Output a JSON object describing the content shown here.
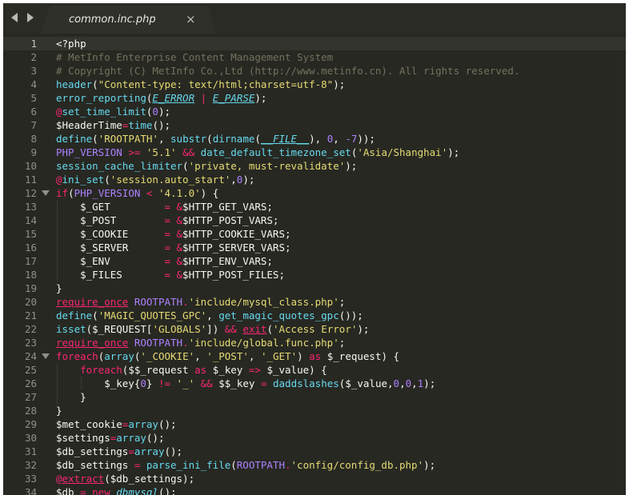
{
  "tabbar": {
    "back_icon": "chevron-left-icon",
    "forward_icon": "chevron-right-icon",
    "tab_title": "common.inc.php",
    "close_glyph": "×"
  },
  "editor": {
    "current_line": 1,
    "fold_lines": [
      12,
      24
    ],
    "lines": [
      {
        "n": "1",
        "tokens": [
          {
            "t": "<?php",
            "c": "d"
          }
        ]
      },
      {
        "n": "2",
        "tokens": [
          {
            "t": "# MetInfo Enterprise Content Management System",
            "c": "c"
          }
        ]
      },
      {
        "n": "3",
        "tokens": [
          {
            "t": "# Copyright (C) MetInfo Co.,Ltd (http://www.metinfo.cn). All rights reserved.",
            "c": "c"
          }
        ]
      },
      {
        "n": "4",
        "tokens": [
          {
            "t": "header",
            "c": "f"
          },
          {
            "t": "(",
            "c": "p"
          },
          {
            "t": "\"Content-type: text/html;charset=utf-8\"",
            "c": "s"
          },
          {
            "t": ");",
            "c": "p"
          }
        ]
      },
      {
        "n": "5",
        "tokens": [
          {
            "t": "error_reporting",
            "c": "f"
          },
          {
            "t": "(",
            "c": "p"
          },
          {
            "t": "E_ERROR",
            "c": "u"
          },
          {
            "t": " | ",
            "c": "k"
          },
          {
            "t": "E_PARSE",
            "c": "u"
          },
          {
            "t": ");",
            "c": "p"
          }
        ]
      },
      {
        "n": "6",
        "tokens": [
          {
            "t": "@",
            "c": "k"
          },
          {
            "t": "set_time_limit",
            "c": "f"
          },
          {
            "t": "(",
            "c": "p"
          },
          {
            "t": "0",
            "c": "n"
          },
          {
            "t": ");",
            "c": "p"
          }
        ]
      },
      {
        "n": "7",
        "tokens": [
          {
            "t": "$HeaderTime",
            "c": "v"
          },
          {
            "t": "=",
            "c": "k"
          },
          {
            "t": "time",
            "c": "f"
          },
          {
            "t": "();",
            "c": "p"
          }
        ]
      },
      {
        "n": "8",
        "tokens": [
          {
            "t": "define",
            "c": "f"
          },
          {
            "t": "(",
            "c": "p"
          },
          {
            "t": "'ROOTPATH'",
            "c": "s"
          },
          {
            "t": ", ",
            "c": "p"
          },
          {
            "t": "substr",
            "c": "f"
          },
          {
            "t": "(",
            "c": "p"
          },
          {
            "t": "dirname",
            "c": "f"
          },
          {
            "t": "(",
            "c": "p"
          },
          {
            "t": "__FILE__",
            "c": "u"
          },
          {
            "t": "), ",
            "c": "p"
          },
          {
            "t": "0",
            "c": "n"
          },
          {
            "t": ", ",
            "c": "p"
          },
          {
            "t": "-7",
            "c": "n"
          },
          {
            "t": "));",
            "c": "p"
          }
        ]
      },
      {
        "n": "9",
        "tokens": [
          {
            "t": "PHP_VERSION",
            "c": "cst"
          },
          {
            "t": " >= ",
            "c": "k"
          },
          {
            "t": "'5.1'",
            "c": "s"
          },
          {
            "t": " && ",
            "c": "k"
          },
          {
            "t": "date_default_timezone_set",
            "c": "f"
          },
          {
            "t": "(",
            "c": "p"
          },
          {
            "t": "'Asia/Shanghai'",
            "c": "s"
          },
          {
            "t": ");",
            "c": "p"
          }
        ]
      },
      {
        "n": "10",
        "tokens": [
          {
            "t": "session_cache_limiter",
            "c": "f"
          },
          {
            "t": "(",
            "c": "p"
          },
          {
            "t": "'private, must-revalidate'",
            "c": "s"
          },
          {
            "t": ");",
            "c": "p"
          }
        ]
      },
      {
        "n": "11",
        "tokens": [
          {
            "t": "@",
            "c": "k"
          },
          {
            "t": "ini_set",
            "c": "f"
          },
          {
            "t": "(",
            "c": "p"
          },
          {
            "t": "'session.auto_start'",
            "c": "s"
          },
          {
            "t": ",",
            "c": "p"
          },
          {
            "t": "0",
            "c": "n"
          },
          {
            "t": ");",
            "c": "p"
          }
        ]
      },
      {
        "n": "12",
        "tokens": [
          {
            "t": "if",
            "c": "k"
          },
          {
            "t": "(",
            "c": "p"
          },
          {
            "t": "PHP_VERSION",
            "c": "cst"
          },
          {
            "t": " < ",
            "c": "k"
          },
          {
            "t": "'4.1.0'",
            "c": "s"
          },
          {
            "t": ") {",
            "c": "p"
          }
        ]
      },
      {
        "n": "13",
        "tokens": [
          {
            "t": "    $_GET         ",
            "c": "v"
          },
          {
            "t": "= &",
            "c": "k"
          },
          {
            "t": "$HTTP_GET_VARS;",
            "c": "v"
          }
        ]
      },
      {
        "n": "14",
        "tokens": [
          {
            "t": "    $_POST        ",
            "c": "v"
          },
          {
            "t": "= &",
            "c": "k"
          },
          {
            "t": "$HTTP_POST_VARS;",
            "c": "v"
          }
        ]
      },
      {
        "n": "15",
        "tokens": [
          {
            "t": "    $_COOKIE      ",
            "c": "v"
          },
          {
            "t": "= &",
            "c": "k"
          },
          {
            "t": "$HTTP_COOKIE_VARS;",
            "c": "v"
          }
        ]
      },
      {
        "n": "16",
        "tokens": [
          {
            "t": "    $_SERVER      ",
            "c": "v"
          },
          {
            "t": "= &",
            "c": "k"
          },
          {
            "t": "$HTTP_SERVER_VARS;",
            "c": "v"
          }
        ]
      },
      {
        "n": "17",
        "tokens": [
          {
            "t": "    $_ENV         ",
            "c": "v"
          },
          {
            "t": "= &",
            "c": "k"
          },
          {
            "t": "$HTTP_ENV_VARS;",
            "c": "v"
          }
        ]
      },
      {
        "n": "18",
        "tokens": [
          {
            "t": "    $_FILES       ",
            "c": "v"
          },
          {
            "t": "= &",
            "c": "k"
          },
          {
            "t": "$HTTP_POST_FILES;",
            "c": "v"
          }
        ]
      },
      {
        "n": "19",
        "tokens": [
          {
            "t": "}",
            "c": "p"
          }
        ]
      },
      {
        "n": "20",
        "tokens": [
          {
            "t": "require_once",
            "c": "kf"
          },
          {
            "t": " ",
            "c": "p"
          },
          {
            "t": "ROOTPATH",
            "c": "cst"
          },
          {
            "t": ".",
            "c": "k"
          },
          {
            "t": "'include/mysql_class.php'",
            "c": "s"
          },
          {
            "t": ";",
            "c": "p"
          }
        ]
      },
      {
        "n": "21",
        "tokens": [
          {
            "t": "define",
            "c": "f"
          },
          {
            "t": "(",
            "c": "p"
          },
          {
            "t": "'MAGIC_QUOTES_GPC'",
            "c": "s"
          },
          {
            "t": ", ",
            "c": "p"
          },
          {
            "t": "get_magic_quotes_gpc",
            "c": "f"
          },
          {
            "t": "());",
            "c": "p"
          }
        ]
      },
      {
        "n": "22",
        "tokens": [
          {
            "t": "isset",
            "c": "f"
          },
          {
            "t": "($_REQUEST[",
            "c": "p"
          },
          {
            "t": "'GLOBALS'",
            "c": "s"
          },
          {
            "t": "]) ",
            "c": "p"
          },
          {
            "t": "&&",
            "c": "k"
          },
          {
            "t": " ",
            "c": "p"
          },
          {
            "t": "exit",
            "c": "kf"
          },
          {
            "t": "(",
            "c": "p"
          },
          {
            "t": "'Access Error'",
            "c": "s"
          },
          {
            "t": ");",
            "c": "p"
          }
        ]
      },
      {
        "n": "23",
        "tokens": [
          {
            "t": "require_once",
            "c": "kf"
          },
          {
            "t": " ",
            "c": "p"
          },
          {
            "t": "ROOTPATH",
            "c": "cst"
          },
          {
            "t": ".",
            "c": "k"
          },
          {
            "t": "'include/global.func.php'",
            "c": "s"
          },
          {
            "t": ";",
            "c": "p"
          }
        ]
      },
      {
        "n": "24",
        "tokens": [
          {
            "t": "foreach",
            "c": "k"
          },
          {
            "t": "(",
            "c": "p"
          },
          {
            "t": "array",
            "c": "f"
          },
          {
            "t": "(",
            "c": "p"
          },
          {
            "t": "'_COOKIE'",
            "c": "s"
          },
          {
            "t": ", ",
            "c": "p"
          },
          {
            "t": "'_POST'",
            "c": "s"
          },
          {
            "t": ", ",
            "c": "p"
          },
          {
            "t": "'_GET'",
            "c": "s"
          },
          {
            "t": ") ",
            "c": "p"
          },
          {
            "t": "as",
            "c": "k"
          },
          {
            "t": " $_request) {",
            "c": "p"
          }
        ]
      },
      {
        "n": "25",
        "tokens": [
          {
            "t": "    ",
            "c": "p"
          },
          {
            "t": "foreach",
            "c": "k"
          },
          {
            "t": "($$_request ",
            "c": "p"
          },
          {
            "t": "as",
            "c": "k"
          },
          {
            "t": " $_key ",
            "c": "p"
          },
          {
            "t": "=>",
            "c": "k"
          },
          {
            "t": " $_value) {",
            "c": "p"
          }
        ]
      },
      {
        "n": "26",
        "tokens": [
          {
            "t": "        $_key{",
            "c": "p"
          },
          {
            "t": "0",
            "c": "n"
          },
          {
            "t": "} ",
            "c": "p"
          },
          {
            "t": "!=",
            "c": "k"
          },
          {
            "t": " ",
            "c": "p"
          },
          {
            "t": "'_'",
            "c": "s"
          },
          {
            "t": " ",
            "c": "p"
          },
          {
            "t": "&&",
            "c": "k"
          },
          {
            "t": " $$_key ",
            "c": "p"
          },
          {
            "t": "=",
            "c": "k"
          },
          {
            "t": " ",
            "c": "p"
          },
          {
            "t": "daddslashes",
            "c": "f"
          },
          {
            "t": "($_value,",
            "c": "p"
          },
          {
            "t": "0",
            "c": "n"
          },
          {
            "t": ",",
            "c": "p"
          },
          {
            "t": "0",
            "c": "n"
          },
          {
            "t": ",",
            "c": "p"
          },
          {
            "t": "1",
            "c": "n"
          },
          {
            "t": ");",
            "c": "p"
          }
        ]
      },
      {
        "n": "27",
        "tokens": [
          {
            "t": "    }",
            "c": "p"
          }
        ]
      },
      {
        "n": "28",
        "tokens": [
          {
            "t": "}",
            "c": "p"
          }
        ]
      },
      {
        "n": "29",
        "tokens": [
          {
            "t": "$met_cookie",
            "c": "v"
          },
          {
            "t": "=",
            "c": "k"
          },
          {
            "t": "array",
            "c": "f"
          },
          {
            "t": "();",
            "c": "p"
          }
        ]
      },
      {
        "n": "30",
        "tokens": [
          {
            "t": "$settings",
            "c": "v"
          },
          {
            "t": "=",
            "c": "k"
          },
          {
            "t": "array",
            "c": "f"
          },
          {
            "t": "();",
            "c": "p"
          }
        ]
      },
      {
        "n": "31",
        "tokens": [
          {
            "t": "$db_settings",
            "c": "v"
          },
          {
            "t": "=",
            "c": "k"
          },
          {
            "t": "array",
            "c": "f"
          },
          {
            "t": "();",
            "c": "p"
          }
        ]
      },
      {
        "n": "32",
        "tokens": [
          {
            "t": "$db_settings",
            "c": "v"
          },
          {
            "t": " = ",
            "c": "k"
          },
          {
            "t": "parse_ini_file",
            "c": "f"
          },
          {
            "t": "(",
            "c": "p"
          },
          {
            "t": "ROOTPATH",
            "c": "cst"
          },
          {
            "t": ".",
            "c": "k"
          },
          {
            "t": "'config/config_db.php'",
            "c": "s"
          },
          {
            "t": ");",
            "c": "p"
          }
        ]
      },
      {
        "n": "33",
        "tokens": [
          {
            "t": "@",
            "c": "k"
          },
          {
            "t": "extract",
            "c": "kf"
          },
          {
            "t": "($db_settings);",
            "c": "p"
          }
        ]
      },
      {
        "n": "34",
        "tokens": [
          {
            "t": "$db",
            "c": "v"
          },
          {
            "t": " = ",
            "c": "k"
          },
          {
            "t": "new",
            "c": "kf"
          },
          {
            "t": " ",
            "c": "p"
          },
          {
            "t": "dbmysql",
            "c": "i"
          },
          {
            "t": "();",
            "c": "p"
          }
        ]
      }
    ]
  },
  "colors": {
    "background": "#272822",
    "tabbar": "#2a2b25",
    "active_tab": "#2f302a",
    "current_line": "#33342e",
    "comment": "#75715e",
    "string": "#e6db74",
    "keyword": "#f92672",
    "function": "#66d9ef",
    "number": "#ae81ff"
  }
}
